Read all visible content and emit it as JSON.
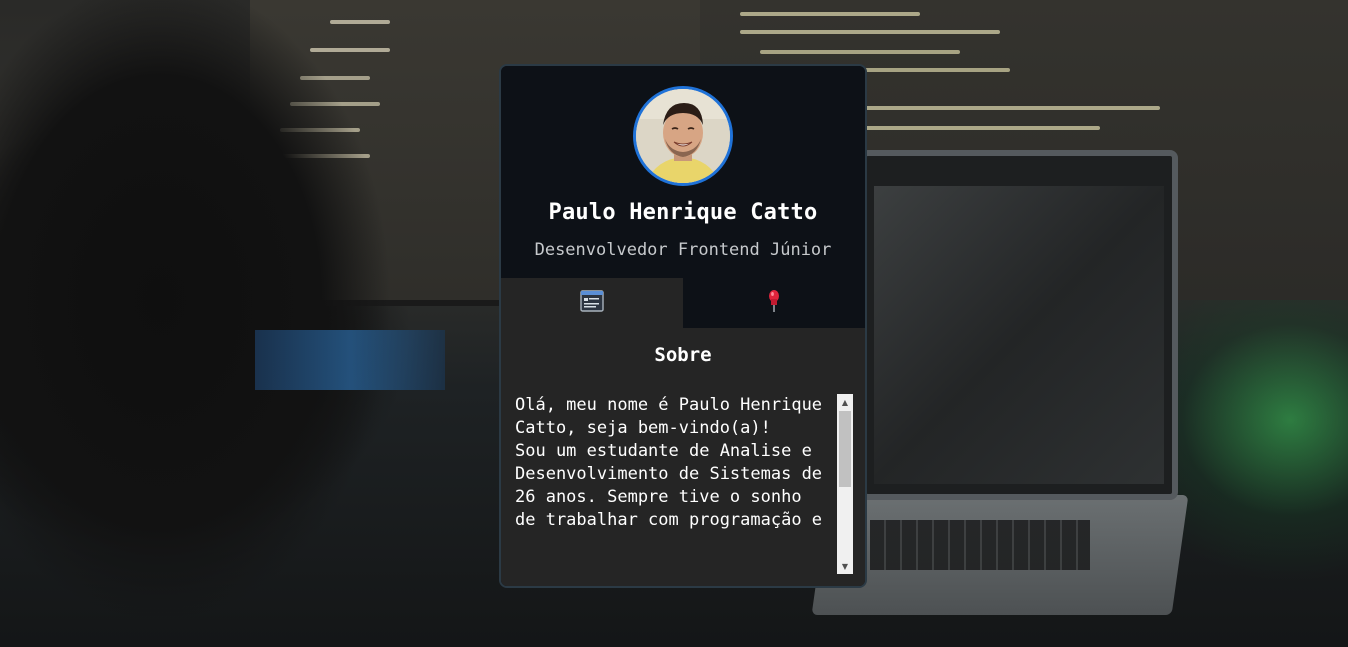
{
  "profile": {
    "name": "Paulo Henrique Catto",
    "role": "Desenvolvedor Frontend Júnior"
  },
  "tabs": [
    {
      "icon": "browser-window-icon",
      "active": true
    },
    {
      "icon": "pin-icon",
      "active": false
    }
  ],
  "about": {
    "title": "Sobre",
    "text": "Olá, meu nome é Paulo Henrique Catto, seja bem-vindo(a)!\nSou um estudante de Analise e Desenvolvimento de Sistemas de 26 anos. Sempre tive o sonho de trabalhar com programação e"
  },
  "colors": {
    "card_bg": "#0d1117",
    "content_bg": "#252525",
    "avatar_border": "#1f72d8",
    "pin_red": "#e0243c"
  }
}
